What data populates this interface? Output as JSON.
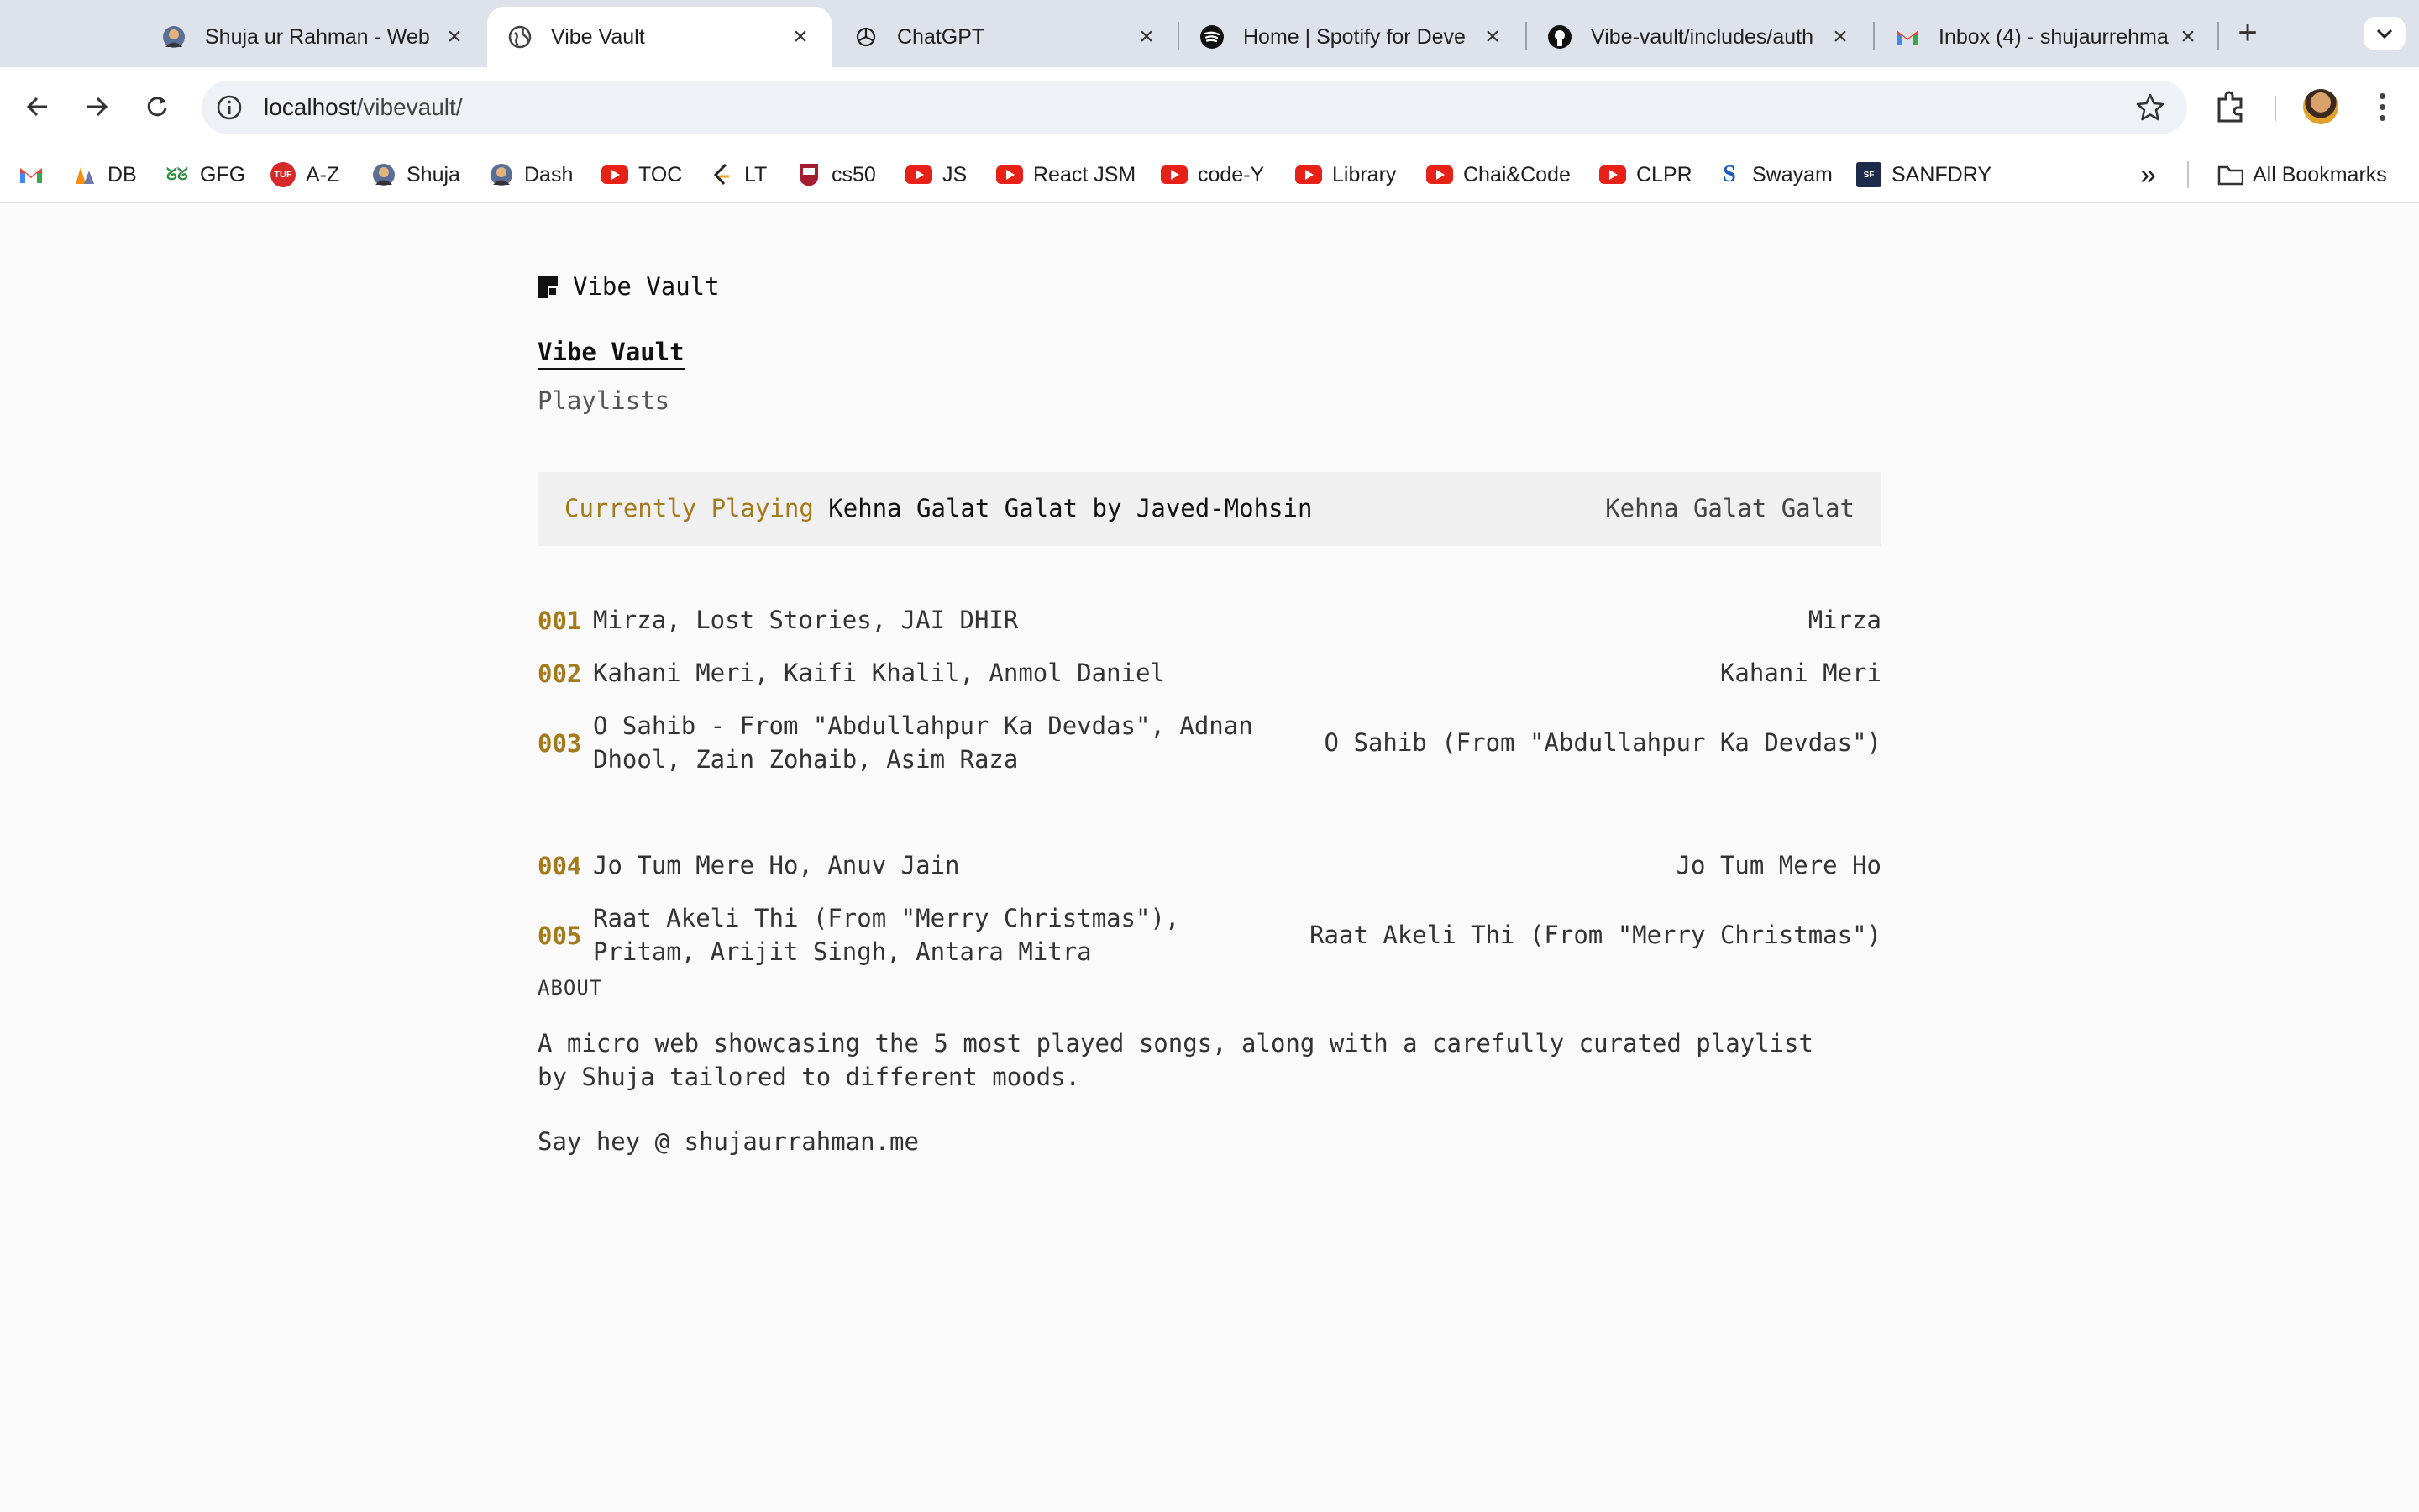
{
  "browser": {
    "tabs": [
      {
        "title": "Shuja ur Rahman - Web",
        "icon": "avatar-favicon"
      },
      {
        "title": "Vibe Vault",
        "icon": "globe-icon"
      },
      {
        "title": "ChatGPT",
        "icon": "openai-icon"
      },
      {
        "title": "Home | Spotify for Deve",
        "icon": "spotify-icon"
      },
      {
        "title": "Vibe-vault/includes/auth",
        "icon": "github-icon"
      },
      {
        "title": "Inbox (4) - shujaurrehma",
        "icon": "gmail-icon"
      }
    ],
    "active_tab": 1,
    "url_host": "localhost",
    "url_path": "/vibevault/",
    "bookmarks": [
      {
        "label": "",
        "icon": "gmail-icon"
      },
      {
        "label": "DB",
        "icon": "pma-icon"
      },
      {
        "label": "GFG",
        "icon": "gfg-icon"
      },
      {
        "label": "A-Z",
        "icon": "tuf-icon"
      },
      {
        "label": "Shuja",
        "icon": "avatar-favicon"
      },
      {
        "label": "Dash",
        "icon": "avatar-favicon"
      },
      {
        "label": "TOC",
        "icon": "youtube-icon"
      },
      {
        "label": "LT",
        "icon": "leetcode-icon"
      },
      {
        "label": "cs50",
        "icon": "harvard-icon"
      },
      {
        "label": "JS",
        "icon": "youtube-icon"
      },
      {
        "label": "React JSM",
        "icon": "youtube-icon"
      },
      {
        "label": "code-Y",
        "icon": "youtube-icon"
      },
      {
        "label": "Library",
        "icon": "youtube-icon"
      },
      {
        "label": "Chai&Code",
        "icon": "youtube-icon"
      },
      {
        "label": "CLPR",
        "icon": "youtube-icon"
      },
      {
        "label": "Swayam",
        "icon": "swayam-icon"
      },
      {
        "label": "SANFDRY",
        "icon": "sanfdry-icon"
      }
    ],
    "all_bookmarks": "All Bookmarks",
    "more_bookmarks": "»"
  },
  "page": {
    "brand": "Vibe Vault",
    "nav_title": "Vibe Vault",
    "nav_sub": "Playlists",
    "now_playing": {
      "label": "Currently Playing",
      "song": "Kehna Galat Galat by Javed-Mohsin",
      "right": "Kehna Galat Galat"
    },
    "tracks": [
      {
        "num": "001",
        "desc": "Mirza, Lost Stories, JAI DHIR",
        "title": "Mirza"
      },
      {
        "num": "002",
        "desc": "Kahani Meri, Kaifi Khalil, Anmol Daniel",
        "title": "Kahani Meri"
      },
      {
        "num": "003",
        "desc": "O Sahib - From \"Abdullahpur Ka Devdas\", Adnan Dhool, Zain Zohaib, Asim Raza",
        "title": "O Sahib (From \"Abdullahpur Ka Devdas\")"
      },
      {
        "num": "004",
        "desc": "Jo Tum Mere Ho, Anuv Jain",
        "title": "Jo Tum Mere Ho"
      },
      {
        "num": "005",
        "desc": "Raat Akeli Thi (From \"Merry Christmas\"), Pritam, Arijit Singh, Antara Mitra",
        "title": "Raat Akeli Thi (From \"Merry Christmas\")"
      }
    ],
    "about_heading": "ABOUT",
    "about_text": "A micro web showcasing the 5 most played songs, along with a carefully curated playlist by Shuja tailored to different moods.",
    "contact": "Say hey @ shujaurrahman.me"
  },
  "colors": {
    "accent": "#a37a1c",
    "page_bg": "#fafafa",
    "now_bar_bg": "#f0f0f0"
  }
}
